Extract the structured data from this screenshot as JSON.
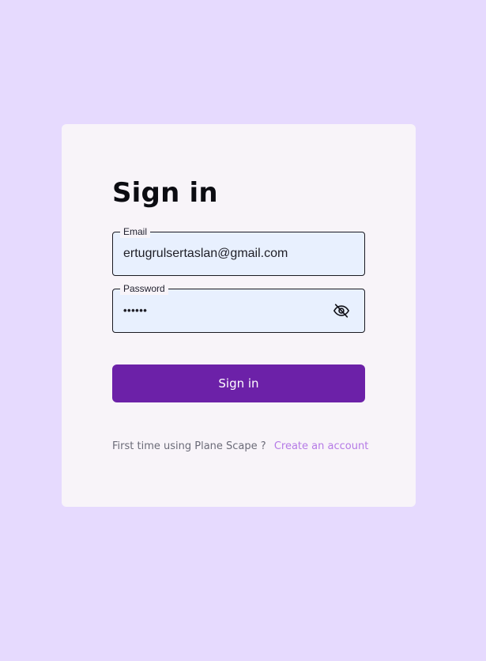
{
  "signin": {
    "title": "Sign in",
    "email": {
      "label": "Email",
      "value": "ertugrulsertaslan@gmail.com"
    },
    "password": {
      "label": "Password",
      "value": "••••••",
      "toggle_icon": "eye-off-icon"
    },
    "submit_label": "Sign in",
    "footer": {
      "prompt": "First time using Plane Scape ?",
      "link_label": "Create an account"
    }
  },
  "colors": {
    "page_background": "#e6dafe",
    "card_background": "#f8f4f9",
    "input_background": "#e8f0fe",
    "primary_button": "#6c21a8",
    "link": "#b57ae6"
  }
}
